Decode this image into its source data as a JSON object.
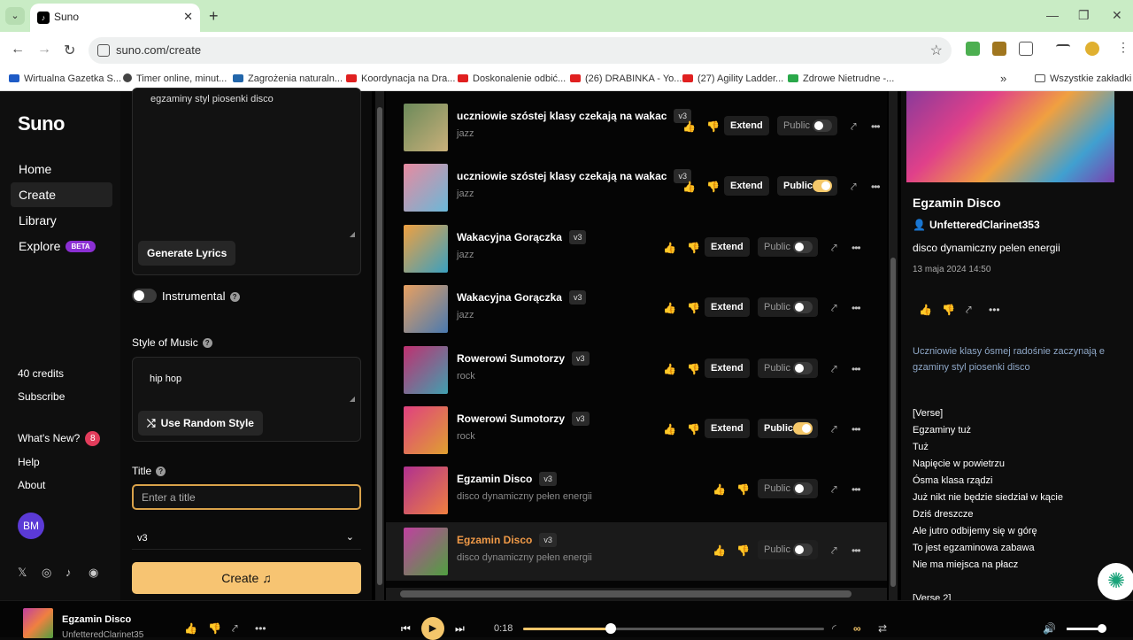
{
  "browser": {
    "tab_title": "Suno",
    "url": "suno.com/create",
    "bookmarks": [
      {
        "label": "Wirtualna Gazetka S...",
        "color": "#1e5bc6"
      },
      {
        "label": "Timer online, minut...",
        "color": "#444444"
      },
      {
        "label": "Zagrożenia naturaln...",
        "color": "#2266aa"
      },
      {
        "label": "Koordynacja na Dra...",
        "color": "#e02020"
      },
      {
        "label": "Doskonalenie odbić...",
        "color": "#e02020"
      },
      {
        "label": "(26) DRABINKA - Yo...",
        "color": "#e02020"
      },
      {
        "label": "(27) Agility Ladder...",
        "color": "#e02020"
      },
      {
        "label": "Zdrowe Nietrudne -...",
        "color": "#2aa84a"
      }
    ],
    "all_bookmarks": "Wszystkie zakładki"
  },
  "sidebar": {
    "logo": "Suno",
    "nav": [
      {
        "label": "Home"
      },
      {
        "label": "Create"
      },
      {
        "label": "Library"
      },
      {
        "label": "Explore",
        "badge": "BETA"
      }
    ],
    "credits": "40 credits",
    "subscribe": "Subscribe",
    "whats_new": "What's New?",
    "whats_new_count": "8",
    "help": "Help",
    "about": "About",
    "avatar": "BM"
  },
  "form": {
    "lyrics_visible": "egzaminy styl piosenki disco",
    "generate_lyrics": "Generate Lyrics",
    "instrumental": "Instrumental",
    "style_label": "Style of Music",
    "style_value": "hip hop",
    "random_style": "Use Random Style",
    "title_label": "Title",
    "title_placeholder": "Enter a title",
    "model": "v3",
    "create": "Create"
  },
  "songs": [
    {
      "title": "uczniowie szóstej klasy czekają na wakac",
      "version": "v3",
      "genre": "jazz",
      "extend": "Extend",
      "public_label": "Public",
      "public": false,
      "colors": [
        "#6c8a5a",
        "#c9b07a"
      ]
    },
    {
      "title": "uczniowie szóstej klasy czekają na wakac",
      "version": "v3",
      "genre": "jazz",
      "extend": "Extend",
      "public_label": "Public",
      "public": true,
      "colors": [
        "#e88aa0",
        "#6ab8d8"
      ]
    },
    {
      "title": "Wakacyjna Gorączka",
      "version": "v3",
      "genre": "jazz",
      "extend": "Extend",
      "public_label": "Public",
      "public": false,
      "colors": [
        "#f0a040",
        "#3aa0c0"
      ]
    },
    {
      "title": "Wakacyjna Gorączka",
      "version": "v3",
      "genre": "jazz",
      "extend": "Extend",
      "public_label": "Public",
      "public": false,
      "colors": [
        "#e8a060",
        "#4a7ab0"
      ]
    },
    {
      "title": "Rowerowi Sumotorzy",
      "version": "v3",
      "genre": "rock",
      "extend": "Extend",
      "public_label": "Public",
      "public": false,
      "colors": [
        "#c03070",
        "#40a0b0"
      ]
    },
    {
      "title": "Rowerowi Sumotorzy",
      "version": "v3",
      "genre": "rock",
      "extend": "Extend",
      "public_label": "Public",
      "public": true,
      "colors": [
        "#e04080",
        "#e0a030"
      ]
    },
    {
      "title": "Egzamin Disco",
      "version": "v3",
      "genre": "disco dynamiczny pełen energii",
      "public_label": "Public",
      "public": false,
      "colors": [
        "#b03090",
        "#f08040"
      ]
    },
    {
      "title": "Egzamin Disco",
      "version": "v3",
      "genre": "disco dynamiczny pełen energii",
      "public_label": "Public",
      "public": false,
      "colors": [
        "#c040a0",
        "#50a040"
      ],
      "active": true
    }
  ],
  "detail": {
    "title": "Egzamin Disco",
    "user": "UnfetteredClarinet353",
    "description": "disco dynamiczny pelen energii",
    "date": "13 maja 2024 14:50",
    "prompt": "Uczniowie klasy ósmej radośnie zaczynają e gzaminy styl piosenki disco",
    "lyrics": [
      "[Verse]",
      "Egzaminy tuż",
      "Tuż",
      "Napięcie w powietrzu",
      "Ósma klasa rządzi",
      "Już nikt nie będzie siedział w kącie",
      "Dziś dreszcze",
      "Ale jutro odbijemy się w górę",
      "To jest egzaminowa zabawa",
      "Nie ma miejsca na płacz",
      "",
      "[Verse 2]"
    ]
  },
  "player": {
    "title": "Egzamin Disco",
    "user": "UnfetteredClarinet35",
    "time": "0:18",
    "progress": 0.29,
    "volume": 0.95
  }
}
